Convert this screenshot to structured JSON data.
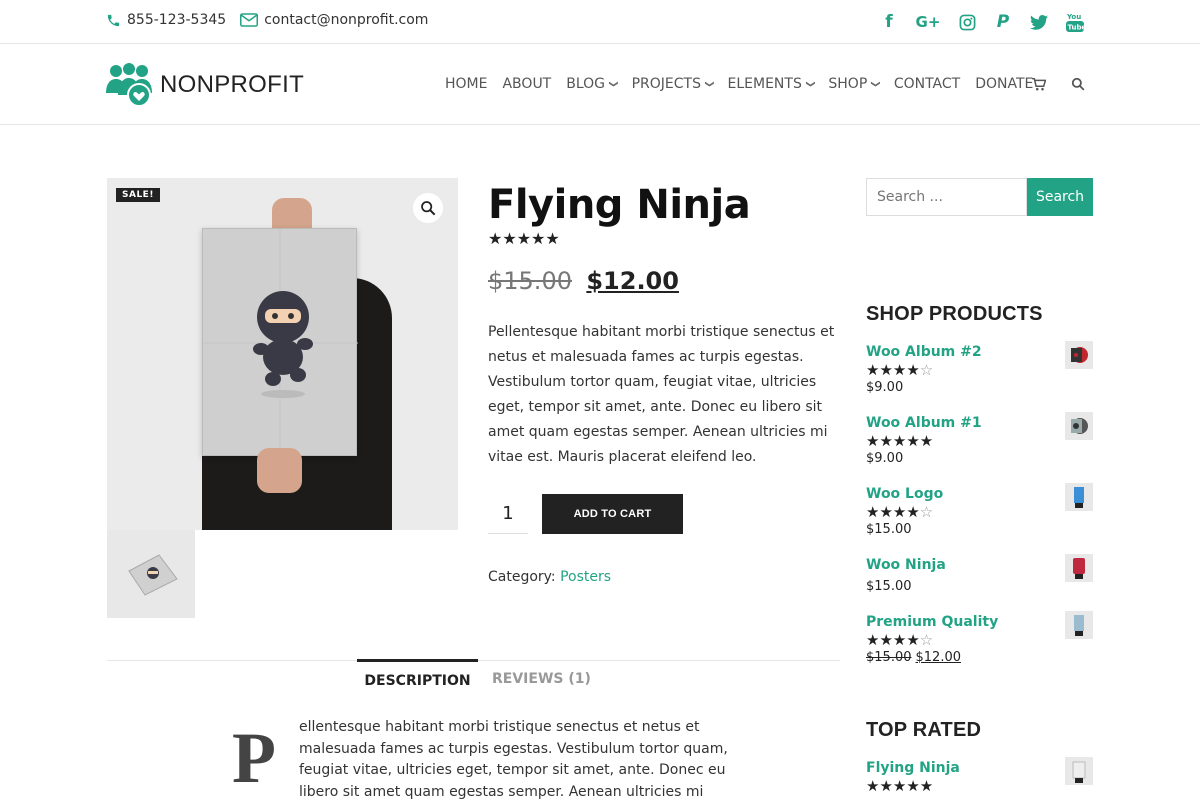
{
  "topbar": {
    "phone": "855-123-5345",
    "email": "contact@nonprofit.com",
    "socials": [
      "facebook-icon",
      "google-plus-icon",
      "instagram-icon",
      "paypal-icon",
      "twitter-icon",
      "youtube-icon"
    ]
  },
  "brand": {
    "name": "NONPROFIT",
    "accent": "#23a385"
  },
  "nav": {
    "items": [
      {
        "label": "HOME",
        "dropdown": false
      },
      {
        "label": "ABOUT",
        "dropdown": false
      },
      {
        "label": "BLOG",
        "dropdown": true
      },
      {
        "label": "PROJECTS",
        "dropdown": true
      },
      {
        "label": "ELEMENTS",
        "dropdown": true
      },
      {
        "label": "SHOP",
        "dropdown": true
      },
      {
        "label": "CONTACT",
        "dropdown": false
      },
      {
        "label": "DONATE",
        "dropdown": false
      }
    ]
  },
  "product": {
    "sale_badge": "SALE!",
    "title": "Flying Ninja",
    "rating_stars": "★★★★★",
    "old_price": "$15.00",
    "price": "$12.00",
    "description": "Pellentesque habitant morbi tristique senectus et netus et malesuada fames ac turpis egestas. Vestibulum tortor quam, feugiat vitae, ultricies eget, tempor sit amet, ante. Donec eu libero sit amet quam egestas semper. Aenean ultricies mi vitae est. Mauris placerat eleifend leo.",
    "quantity": "1",
    "add_to_cart": "ADD TO CART",
    "category_label": "Category:",
    "category": "Posters"
  },
  "tabs": {
    "description": "DESCRIPTION",
    "reviews": "REVIEWS (1)",
    "dropcap": "P",
    "text": "ellentesque habitant morbi tristique senectus et netus et malesuada fames ac turpis egestas. Vestibulum tortor quam, feugiat vitae, ultricies eget, tempor sit amet, ante. Donec eu libero sit amet quam egestas semper. Aenean ultricies mi vitae est."
  },
  "sidebar": {
    "search_placeholder": "Search ...",
    "search_button": "Search",
    "shop_products_title": "SHOP PRODUCTS",
    "shop_products": [
      {
        "name": "Woo Album #2",
        "stars_filled": "★★★★",
        "stars_empty": "☆",
        "price": "$9.00",
        "old_price": ""
      },
      {
        "name": "Woo Album #1",
        "stars_filled": "★★★★★",
        "stars_empty": "",
        "price": "$9.00",
        "old_price": ""
      },
      {
        "name": "Woo Logo",
        "stars_filled": "★★★★",
        "stars_empty": "☆",
        "price": "$15.00",
        "old_price": ""
      },
      {
        "name": "Woo Ninja",
        "stars_filled": "",
        "stars_empty": "",
        "price": "$15.00",
        "old_price": ""
      },
      {
        "name": "Premium Quality",
        "stars_filled": "★★★★",
        "stars_empty": "☆",
        "price": "$12.00",
        "old_price": "$15.00"
      }
    ],
    "top_rated_title": "TOP RATED",
    "top_rated": [
      {
        "name": "Flying Ninja",
        "stars_filled": "★★★★★",
        "stars_empty": ""
      }
    ]
  }
}
